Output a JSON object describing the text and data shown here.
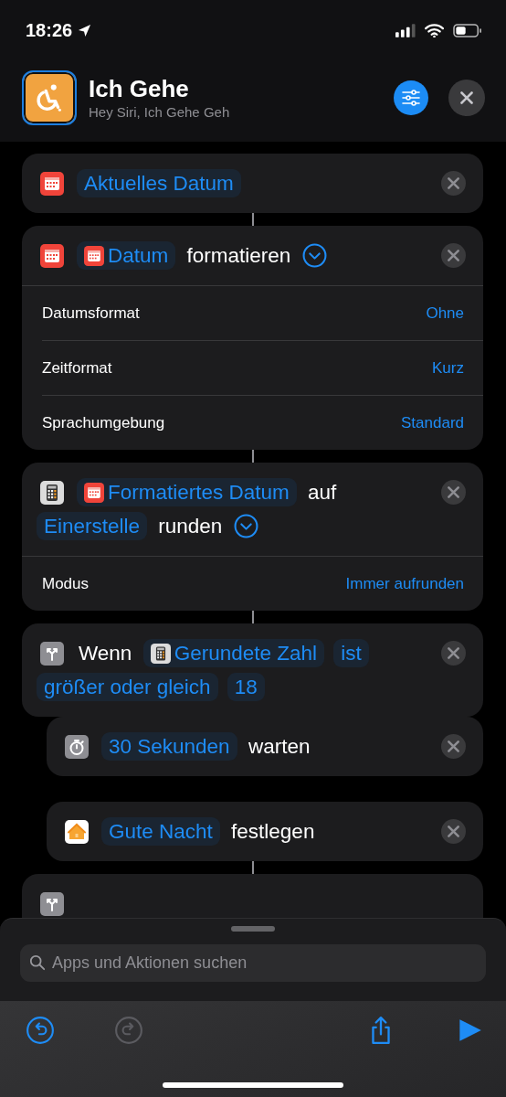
{
  "status_bar": {
    "time": "18:26"
  },
  "header": {
    "title": "Ich Gehe",
    "subtitle": "Hey Siri, Ich Gehe Geh"
  },
  "actions": [
    {
      "kind": "calendar",
      "connector": false,
      "tokens": [
        {
          "kind": "variable",
          "text": "Aktuelles Datum"
        }
      ]
    },
    {
      "kind": "calendar",
      "connector": true,
      "tokens": [
        {
          "kind": "calendar-variable",
          "text": "Datum"
        },
        {
          "kind": "text",
          "text": "formatieren"
        },
        {
          "kind": "chevron"
        }
      ],
      "parameters": [
        {
          "label": "Datumsformat",
          "value": "Ohne"
        },
        {
          "label": "Zeitformat",
          "value": "Kurz"
        },
        {
          "label": "Sprachumgebung",
          "value": "Standard"
        }
      ]
    },
    {
      "kind": "calculator",
      "connector": true,
      "tokens": [
        {
          "kind": "calendar-variable",
          "text": "Formatiertes Datum"
        },
        {
          "kind": "text",
          "text": "auf"
        },
        {
          "kind": "variable",
          "text": "Einerstelle"
        },
        {
          "kind": "text",
          "text": "runden"
        },
        {
          "kind": "chevron"
        }
      ],
      "parameters": [
        {
          "label": "Modus",
          "value": "Immer aufrunden"
        }
      ]
    },
    {
      "kind": "condition",
      "connector": true,
      "tokens": [
        {
          "kind": "text",
          "text": "Wenn"
        },
        {
          "kind": "calculator-variable",
          "text": "Gerundete Zahl"
        },
        {
          "kind": "wide-variable",
          "text": "ist"
        },
        {
          "kind": "variable",
          "text": "größer oder gleich"
        },
        {
          "kind": "variable",
          "text": "18"
        }
      ],
      "children": [
        {
          "kind": "timer",
          "connector": false,
          "tokens": [
            {
              "kind": "variable",
              "text": "30 Sekunden"
            },
            {
              "kind": "text",
              "text": "warten"
            }
          ]
        },
        {
          "kind": "home",
          "connector": false,
          "tokens": [
            {
              "kind": "variable",
              "text": "Gute Nacht"
            },
            {
              "kind": "text",
              "text": "festlegen"
            }
          ]
        }
      ]
    },
    {
      "kind": "condition",
      "connector": true
    }
  ],
  "search": {
    "placeholder": "Apps und Aktionen suchen"
  },
  "toolbar": [
    {
      "kind": "undo",
      "disabled": false
    },
    {
      "kind": "redo",
      "disabled": true
    },
    {
      "kind": "share",
      "disabled": false
    },
    {
      "kind": "run",
      "disabled": false
    }
  ]
}
